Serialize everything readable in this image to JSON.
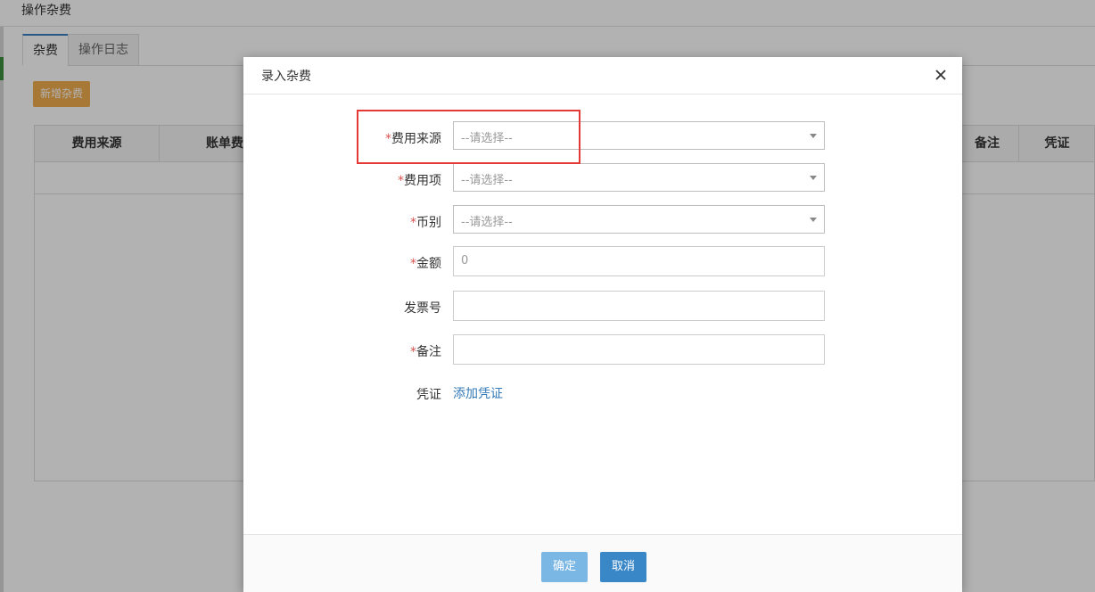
{
  "window": {
    "title": "操作杂费"
  },
  "tabs": [
    {
      "label": "杂费"
    },
    {
      "label": "操作日志"
    }
  ],
  "toolbar": {
    "add_label": "新增杂费"
  },
  "table": {
    "headers": [
      "费用来源",
      "账单费用",
      "备注",
      "凭证"
    ]
  },
  "modal": {
    "title": "录入杂费",
    "required_mark": "*",
    "fields": {
      "source": {
        "label": "费用来源",
        "placeholder": "--请选择--"
      },
      "item": {
        "label": "费用项",
        "placeholder": "--请选择--"
      },
      "currency": {
        "label": "币别",
        "placeholder": "--请选择--"
      },
      "amount": {
        "label": "金额",
        "value": "0"
      },
      "invoice": {
        "label": "发票号",
        "value": ""
      },
      "remark": {
        "label": "备注",
        "value": ""
      },
      "voucher": {
        "label": "凭证",
        "link": "添加凭证"
      }
    },
    "ok_label": "确定",
    "cancel_label": "取消"
  },
  "colors": {
    "accent": "#3a87c8",
    "required": "#d9534f",
    "warning_button": "#f0ad4e",
    "highlight": "#e53935"
  }
}
